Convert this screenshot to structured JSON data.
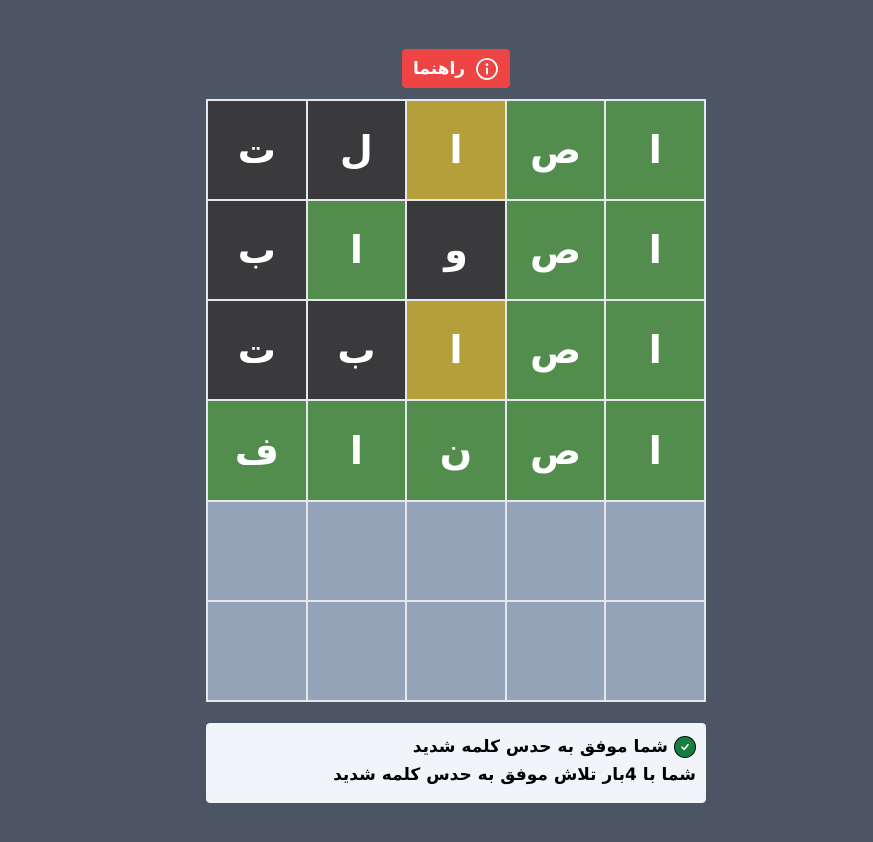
{
  "help_button": {
    "label": "راهنما",
    "icon": "info-icon",
    "color": "#ef4444"
  },
  "colors": {
    "correct": "#538d4e",
    "present": "#b59f3b",
    "absent": "#3a3a3c",
    "empty": "#94a3b8",
    "background": "#4b5563"
  },
  "board": {
    "rows": [
      [
        {
          "letter": "ا",
          "state": "correct"
        },
        {
          "letter": "ص",
          "state": "correct"
        },
        {
          "letter": "ا",
          "state": "present"
        },
        {
          "letter": "ل",
          "state": "absent"
        },
        {
          "letter": "ت",
          "state": "absent"
        }
      ],
      [
        {
          "letter": "ا",
          "state": "correct"
        },
        {
          "letter": "ص",
          "state": "correct"
        },
        {
          "letter": "و",
          "state": "absent"
        },
        {
          "letter": "ا",
          "state": "correct"
        },
        {
          "letter": "ب",
          "state": "absent"
        }
      ],
      [
        {
          "letter": "ا",
          "state": "correct"
        },
        {
          "letter": "ص",
          "state": "correct"
        },
        {
          "letter": "ا",
          "state": "present"
        },
        {
          "letter": "ب",
          "state": "absent"
        },
        {
          "letter": "ت",
          "state": "absent"
        }
      ],
      [
        {
          "letter": "ا",
          "state": "correct"
        },
        {
          "letter": "ص",
          "state": "correct"
        },
        {
          "letter": "ن",
          "state": "correct"
        },
        {
          "letter": "ا",
          "state": "correct"
        },
        {
          "letter": "ف",
          "state": "correct"
        }
      ],
      [
        {
          "letter": "",
          "state": "empty"
        },
        {
          "letter": "",
          "state": "empty"
        },
        {
          "letter": "",
          "state": "empty"
        },
        {
          "letter": "",
          "state": "empty"
        },
        {
          "letter": "",
          "state": "empty"
        }
      ],
      [
        {
          "letter": "",
          "state": "empty"
        },
        {
          "letter": "",
          "state": "empty"
        },
        {
          "letter": "",
          "state": "empty"
        },
        {
          "letter": "",
          "state": "empty"
        },
        {
          "letter": "",
          "state": "empty"
        }
      ]
    ]
  },
  "result": {
    "icon": "check-circle-icon",
    "message": "شما موفق به حدس کلمه شدید",
    "detail": "شما با 4بار تلاش موفق به حدس کلمه شدید"
  }
}
